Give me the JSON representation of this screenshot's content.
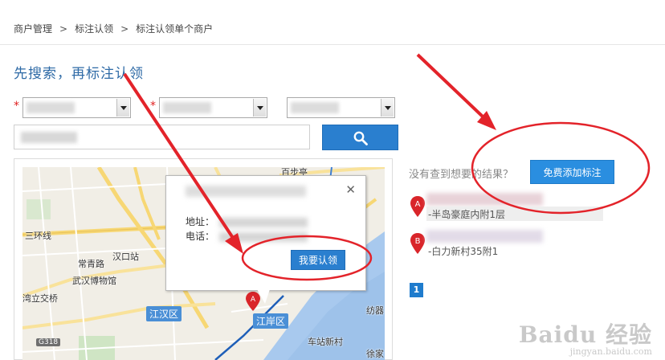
{
  "breadcrumb": {
    "items": [
      "商户管理",
      "标注认领",
      "标注认领单个商户"
    ],
    "separator": ">"
  },
  "page_title": "先搜索，再标注认领",
  "form": {
    "required_mark": "*",
    "select_1": {
      "selected": ""
    },
    "select_2": {
      "selected": ""
    },
    "select_3": {
      "selected": ""
    },
    "search_input": {
      "value": ""
    },
    "search_button_icon": "search-icon"
  },
  "map": {
    "labels": [
      "百步亭",
      "三环线",
      "汉口站",
      "常青路",
      "武汉博物馆",
      "湾立交桥",
      "纺器",
      "车站新村",
      "徐家"
    ],
    "districts": [
      "江汉区",
      "江岸区"
    ],
    "highway": "G318",
    "popup": {
      "address_label": "地址：",
      "phone_label": "电话：",
      "claim_button": "我要认领",
      "close": "✕"
    },
    "marker_letter": "A"
  },
  "results": {
    "no_result_text": "没有查到想要的结果？",
    "add_button": "免费添加标注",
    "items": [
      {
        "letter": "A",
        "address": "-半岛豪庭内附1层"
      },
      {
        "letter": "B",
        "address": "-白力新村35附1"
      }
    ],
    "current_page": "1"
  },
  "watermark": {
    "main": "Baidu 经验",
    "url": "jingyan.baidu.com"
  },
  "colors": {
    "accent": "#2a7fcf",
    "title": "#2e6aa6",
    "marker_red": "#d9252a",
    "annotation_red": "#e3232a"
  }
}
